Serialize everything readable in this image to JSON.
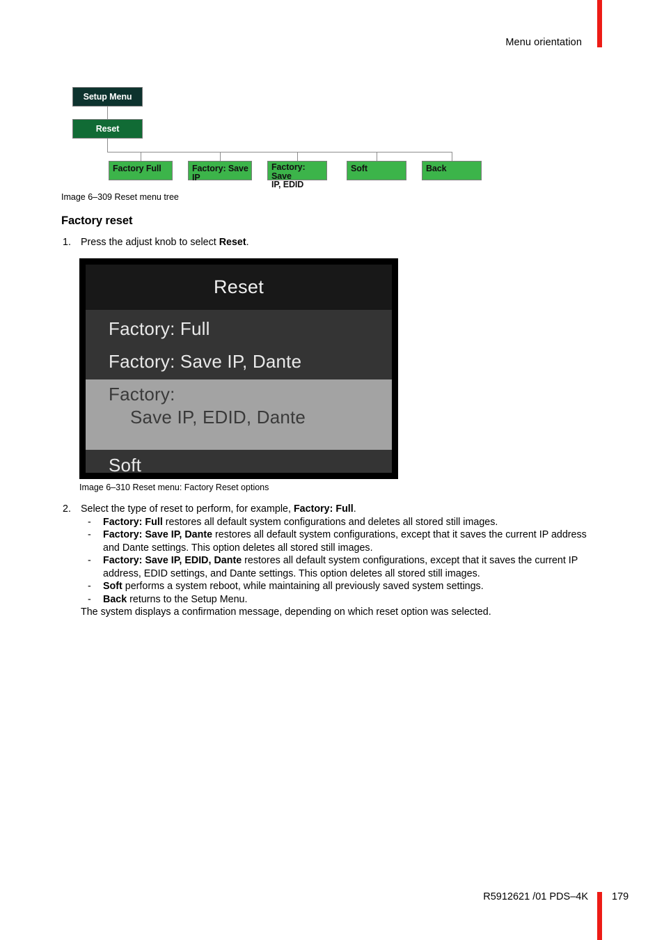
{
  "page": {
    "running_head": "Menu orientation",
    "footer_doc": "R5912621 /01  PDS–4K",
    "footer_page": "179",
    "accent_color": "#ed1c16"
  },
  "tree_figure": {
    "caption": "Image 6–309  Reset menu tree",
    "root": {
      "label": "Setup Menu",
      "color": "#0d332e"
    },
    "level2": {
      "label": "Reset",
      "color": "#116b35"
    },
    "leaves": [
      {
        "label": "Factory Full",
        "color": "#3cb44a"
      },
      {
        "label": "Factory: Save IP",
        "color": "#3cb44a"
      },
      {
        "label_line1": "Factory: Save",
        "label_line2": "IP, EDID",
        "color": "#3cb44a"
      },
      {
        "label": "Soft",
        "color": "#3cb44a"
      },
      {
        "label": "Back",
        "color": "#3cb44a"
      }
    ]
  },
  "section": {
    "title": "Factory reset"
  },
  "steps": {
    "step1": {
      "number": "1.",
      "text_pre": "Press the adjust knob to select ",
      "text_bold": "Reset",
      "text_post": "."
    },
    "step2": {
      "number": "2.",
      "text_pre": "Select the type of reset to perform, for example, ",
      "text_bold": "Factory: Full",
      "text_post": ".",
      "bullets": [
        {
          "dash": "-",
          "bold": "Factory: Full",
          "text": " restores all default system configurations and deletes all stored still images."
        },
        {
          "dash": "-",
          "bold": "Factory: Save IP, Dante",
          "text": " restores all default system configurations, except that it saves the current IP address and Dante settings. This option deletes all stored still images."
        },
        {
          "dash": "-",
          "bold": "Factory: Save IP, EDID, Dante",
          "text": " restores all default system configurations, except that it saves the current IP address, EDID settings, and Dante settings. This option deletes all stored still images."
        },
        {
          "dash": "-",
          "bold": "Soft",
          "text": " performs a system reboot, while maintaining all previously saved system settings."
        },
        {
          "dash": "-",
          "bold": "Back",
          "text": " returns to the Setup Menu."
        }
      ],
      "trailer": "The system displays a confirmation message, depending on which reset option was selected."
    }
  },
  "screen_figure": {
    "caption": "Image 6–310  Reset menu: Factory Reset options",
    "title": "Reset",
    "rows": [
      {
        "label": "Factory: Full",
        "selected": false
      },
      {
        "label": "Factory: Save IP, Dante",
        "selected": false
      },
      {
        "label_line1": "Factory:",
        "label_line2": "Save IP, EDID, Dante",
        "selected": true
      },
      {
        "label": "Soft",
        "selected": false
      }
    ],
    "colors": {
      "bezel": "#000000",
      "title_bg": "#181818",
      "row_bg": "#343434",
      "row_fg": "#e9e9e9",
      "selected_bg": "#a3a3a3",
      "selected_fg": "#3a3a3a"
    }
  }
}
